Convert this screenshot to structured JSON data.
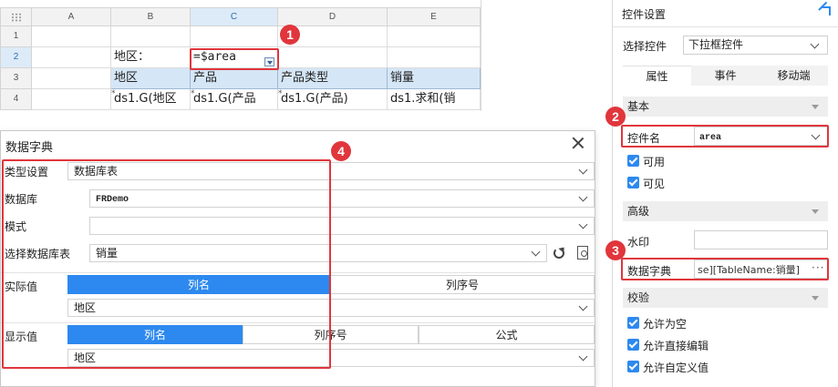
{
  "sheet": {
    "columns": [
      "A",
      "B",
      "C",
      "D",
      "E"
    ],
    "rows": [
      "1",
      "2",
      "3",
      "4"
    ],
    "b2": "地区：",
    "c2": "=$area",
    "headers": [
      "地区",
      "产品",
      "产品类型",
      "销量"
    ],
    "row4": [
      "ds1.G(地区",
      "ds1.G(产品",
      "ds1.G(产品)",
      "ds1.求和(销"
    ]
  },
  "badges": [
    "1",
    "2",
    "3",
    "4"
  ],
  "dialog": {
    "title": "数据字典",
    "type_label": "类型设置",
    "type_value": "数据库表",
    "db_label": "数据库",
    "db_value": "FRDemo",
    "schema_label": "模式",
    "schema_value": "",
    "table_label": "选择数据库表",
    "table_value": "销量",
    "actual_label": "实际值",
    "actual_tabs": [
      "列名",
      "列序号"
    ],
    "actual_value": "地区",
    "display_label": "显示值",
    "display_tabs": [
      "列名",
      "列序号",
      "公式"
    ],
    "display_value": "地区"
  },
  "panel": {
    "title": "控件设置",
    "select_label": "选择控件",
    "select_value": "下拉框控件",
    "tabs": [
      "属性",
      "事件",
      "移动端"
    ],
    "basic_section": "基本",
    "name_label": "控件名",
    "name_value": "area",
    "enabled": "可用",
    "visible": "可见",
    "advanced_section": "高级",
    "watermark_label": "水印",
    "dict_label": "数据字典",
    "dict_value": "se][TableName:销量]",
    "dict_ellipsis": "···",
    "validation_section": "校验",
    "allow_empty": "允许为空",
    "allow_edit": "允许直接编辑",
    "allow_custom": "允许自定义值"
  },
  "colors": {
    "highlight": "#e0363c",
    "accent": "#2d89ef",
    "header_fill": "#d5e6f6"
  }
}
